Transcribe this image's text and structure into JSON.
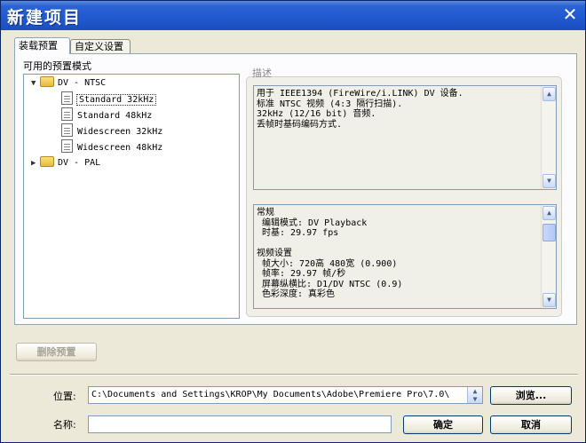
{
  "window": {
    "title": "新建项目"
  },
  "tabs": [
    {
      "label": "装载预置",
      "active": true
    },
    {
      "label": "自定义设置",
      "active": false
    }
  ],
  "presets": {
    "label": "可用的预置模式",
    "tree": [
      {
        "label": "DV - NTSC",
        "expanded": true,
        "children": [
          {
            "label": "Standard 32kHz",
            "selected": true
          },
          {
            "label": "Standard 48kHz"
          },
          {
            "label": "Widescreen 32kHz"
          },
          {
            "label": "Widescreen 48kHz"
          }
        ]
      },
      {
        "label": "DV - PAL",
        "expanded": false
      }
    ]
  },
  "description": {
    "label": "描述",
    "text": "用于 IEEE1394 (FireWire/i.LINK) DV 设备.\n标准 NTSC 视频 (4:3 隔行扫描).\n32kHz (12/16 bit) 音频.\n丢帧时基码编码方式.",
    "details": "常规\n 编辑模式: DV Playback\n 时基: 29.97 fps\n\n视频设置\n 帧大小: 720高 480宽 (0.900)\n 帧率: 29.97 帧/秒\n 屏幕纵横比: D1/DV NTSC (0.9)\n 色彩深度: 真彩色"
  },
  "buttons": {
    "delete_preset": "删除预置",
    "browse": "浏览...",
    "ok": "确定",
    "cancel": "取消"
  },
  "location": {
    "label": "位置:",
    "value": "C:\\Documents and Settings\\KROP\\My Documents\\Adobe\\Premiere Pro\\7.0\\"
  },
  "name": {
    "label": "名称:",
    "value": ""
  },
  "icons": {
    "close": "close-icon",
    "folder": "folder-icon",
    "preset": "preset-file-icon",
    "scroll_up": "scroll-up-icon",
    "scroll_down": "scroll-down-icon",
    "dropdown": "chevron-down-icon"
  }
}
